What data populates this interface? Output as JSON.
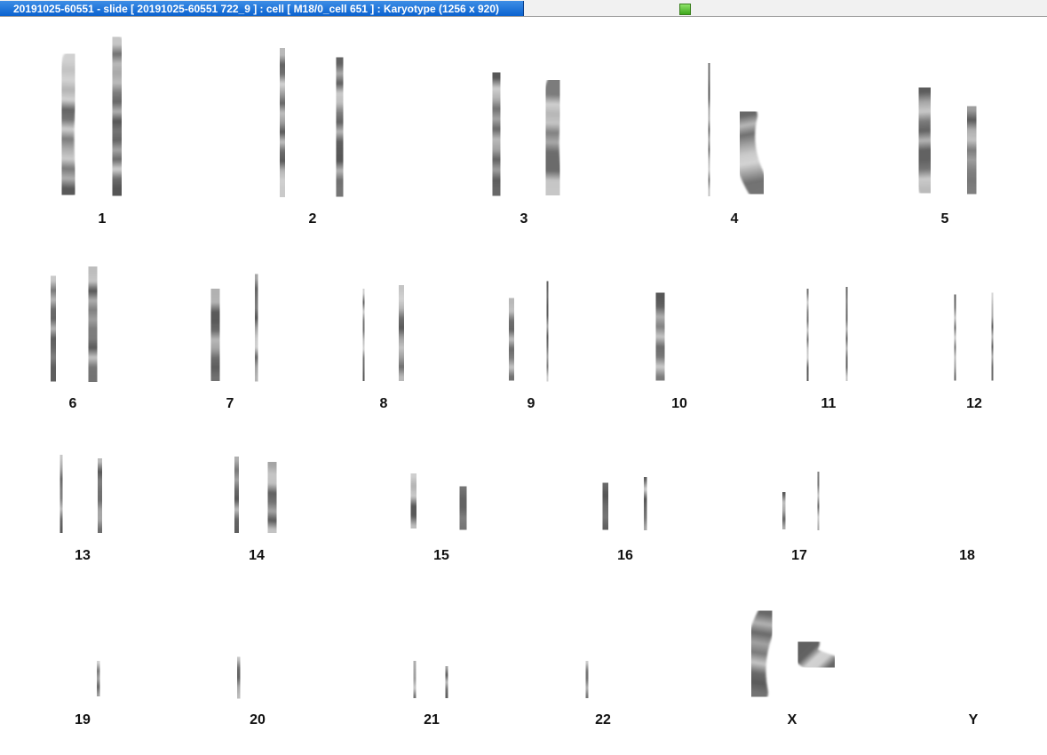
{
  "window": {
    "title": "20191025-60551 - slide [ 20191025-60551 722_9 ] : cell [ M18/0_cell 651 ] : Karyotype  (1256 x 920)"
  },
  "karyotype": {
    "labels": [
      "1",
      "2",
      "3",
      "4",
      "5",
      "6",
      "7",
      "8",
      "9",
      "10",
      "11",
      "12",
      "13",
      "14",
      "15",
      "16",
      "17",
      "18",
      "19",
      "20",
      "21",
      "22",
      "X",
      "Y"
    ]
  }
}
